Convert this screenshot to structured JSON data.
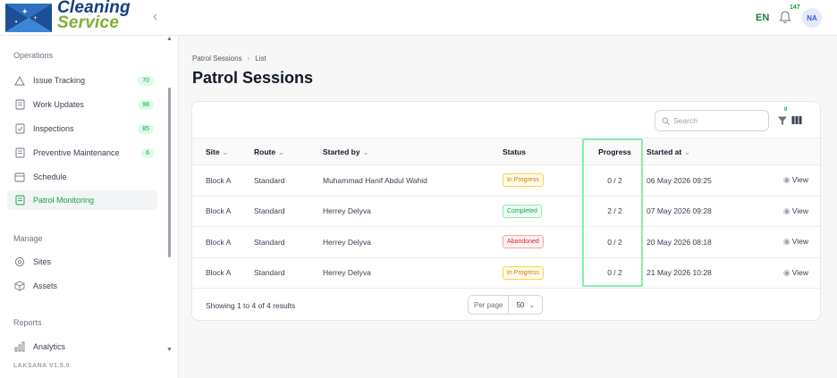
{
  "brand": {
    "line1": "Cleaning",
    "line2": "Service"
  },
  "header": {
    "language": "EN",
    "notification_count": "147",
    "avatar_initials": "NA"
  },
  "sidebar": {
    "groups": [
      {
        "label": "Operations"
      },
      {
        "label": "Manage"
      },
      {
        "label": "Reports"
      }
    ],
    "items": [
      {
        "label": "Issue Tracking",
        "badge": "70",
        "icon": "warning-icon"
      },
      {
        "label": "Work Updates",
        "badge": "98",
        "icon": "document-icon"
      },
      {
        "label": "Inspections",
        "badge": "85",
        "icon": "checklist-icon"
      },
      {
        "label": "Preventive Maintenance",
        "badge": "6",
        "icon": "document-icon"
      },
      {
        "label": "Schedule",
        "icon": "calendar-icon"
      },
      {
        "label": "Patrol Monitoring",
        "icon": "document-icon",
        "active": true
      },
      {
        "label": "Sites",
        "icon": "location-icon"
      },
      {
        "label": "Assets",
        "icon": "cube-icon"
      },
      {
        "label": "Analytics",
        "icon": "bar-chart-icon"
      }
    ],
    "version": "LAKSANA V1.5.0"
  },
  "breadcrumb": {
    "parent": "Patrol Sessions",
    "current": "List"
  },
  "page": {
    "title": "Patrol Sessions"
  },
  "toolbar": {
    "search_placeholder": "Search",
    "filter_count": "0"
  },
  "table": {
    "columns": [
      "Site",
      "Route",
      "Started by",
      "Status",
      "Progress",
      "Started at"
    ],
    "rows": [
      {
        "site": "Block A",
        "route": "Standard",
        "started_by": "Muhammad Hanif Abdul Wahid",
        "status": "In Progress",
        "progress": "0 / 2",
        "started_at": "06 May 2026 09:25",
        "action": "View"
      },
      {
        "site": "Block A",
        "route": "Standard",
        "started_by": "Herrey Delyva",
        "status": "Completed",
        "progress": "2 / 2",
        "started_at": "07 May 2026 09:28",
        "action": "View"
      },
      {
        "site": "Block A",
        "route": "Standard",
        "started_by": "Herrey Delyva",
        "status": "Abandoned",
        "progress": "0 / 2",
        "started_at": "20 May 2026 08:18",
        "action": "View"
      },
      {
        "site": "Block A",
        "route": "Standard",
        "started_by": "Herrey Delyva",
        "status": "In Progress",
        "progress": "0 / 2",
        "started_at": "21 May 2026 10:28",
        "action": "View"
      }
    ]
  },
  "footer": {
    "summary": "Showing 1 to 4 of 4 results",
    "per_page_label": "Per page",
    "per_page_value": "50"
  },
  "colors": {
    "accent": "#16a34a",
    "brand_blue": "#143d7d",
    "brand_green": "#7fb035"
  }
}
